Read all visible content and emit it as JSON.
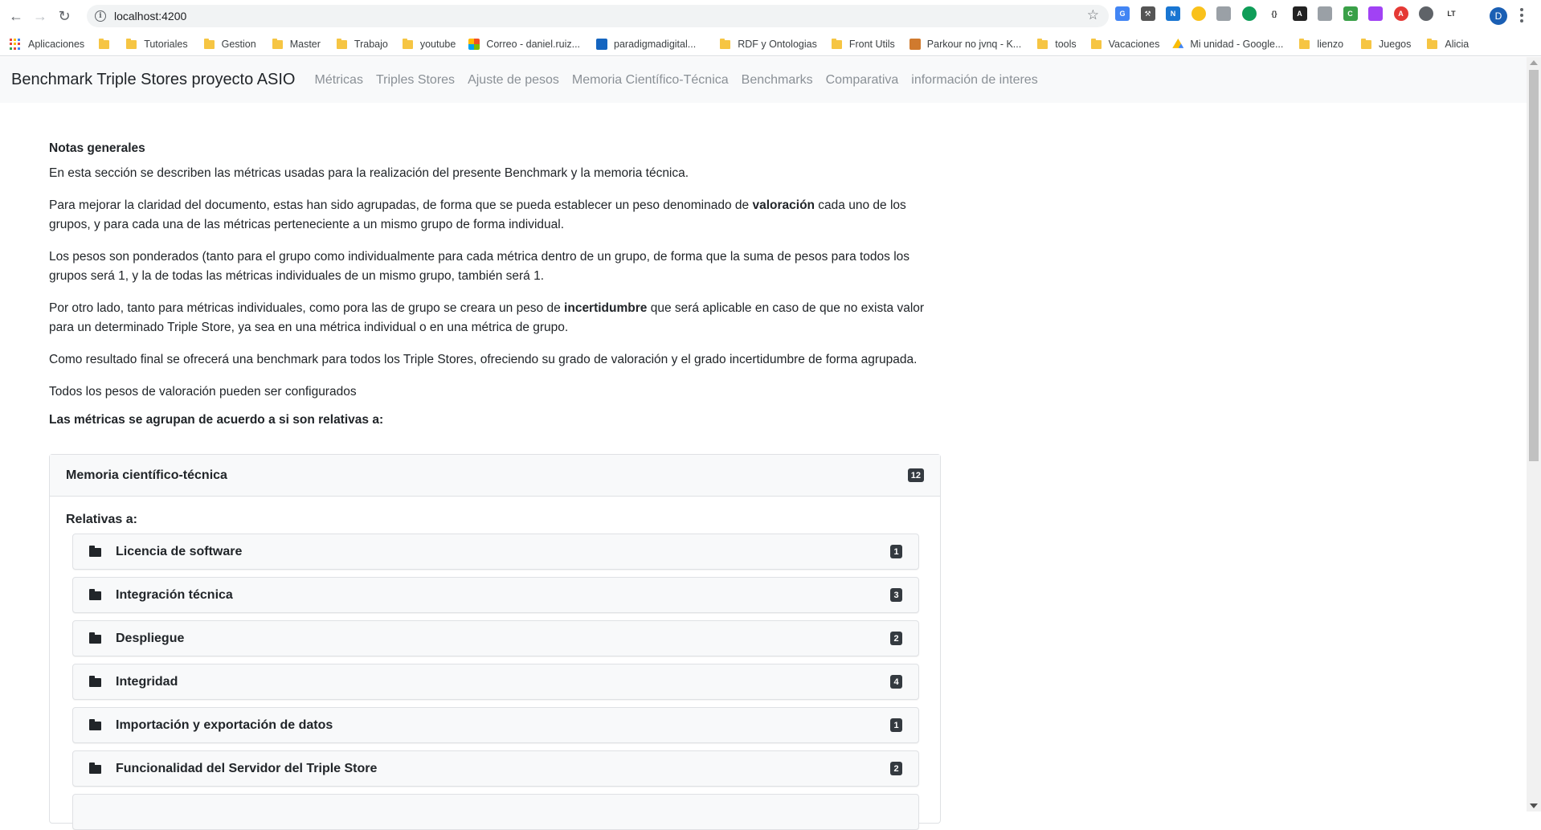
{
  "browser": {
    "url": "localhost:4200",
    "bookmarks": [
      {
        "label": "Aplicaciones",
        "icon": "apps-grid-icon"
      },
      {
        "label": "",
        "icon": "folder-icon"
      },
      {
        "label": "Tutoriales",
        "icon": "folder-icon"
      },
      {
        "label": "Gestion",
        "icon": "folder-icon"
      },
      {
        "label": "Master",
        "icon": "folder-icon"
      },
      {
        "label": "Trabajo",
        "icon": "folder-icon"
      },
      {
        "label": "youtube",
        "icon": "folder-icon"
      },
      {
        "label": "Correo - daniel.ruiz...",
        "icon": "microsoft-icon"
      },
      {
        "label": "paradigmadigital...",
        "icon": "paradigma-icon"
      },
      {
        "label": "RDF y Ontologias",
        "icon": "folder-icon"
      },
      {
        "label": "Front Utils",
        "icon": "folder-icon"
      },
      {
        "label": "Parkour no jvnq - K...",
        "icon": "parkour-icon"
      },
      {
        "label": "tools",
        "icon": "folder-icon"
      },
      {
        "label": "Vacaciones",
        "icon": "folder-icon"
      },
      {
        "label": "Mi unidad - Google...",
        "icon": "google-drive-icon"
      },
      {
        "label": "lienzo",
        "icon": "folder-icon"
      },
      {
        "label": "Juegos",
        "icon": "folder-icon"
      },
      {
        "label": "Alicia",
        "icon": "folder-icon"
      }
    ],
    "profile_initial": "D"
  },
  "navbar": {
    "brand": "Benchmark Triple Stores proyecto ASIO",
    "links": [
      "Métricas",
      "Triples Stores",
      "Ajuste de pesos",
      "Memoria Científico-Técnica",
      "Benchmarks",
      "Comparativa",
      "información de interes"
    ]
  },
  "notes": {
    "heading": "Notas generales",
    "p1": "En esta sección se describen las métricas usadas para la realización del presente Benchmark y la memoria técnica.",
    "p2_a": "Para mejorar la claridad del documento, estas han sido agrupadas, de forma que se pueda establecer un peso denominado de ",
    "p2_bold": "valoración",
    "p2_b": " cada uno de los grupos, y para cada una de las métricas perteneciente a un mismo grupo de forma individual.",
    "p3": "Los pesos son ponderados (tanto para el grupo como individualmente para cada métrica dentro de un grupo, de forma que la suma de pesos para todos los grupos será 1, y la de todas las métricas individuales de un mismo grupo, también será 1.",
    "p4_a": "Por otro lado, tanto para métricas individuales, como pora las de grupo se creara un peso de ",
    "p4_bold": "incertidumbre",
    "p4_b": " que será aplicable en caso de que no exista valor para un determinado Triple Store, ya sea en una métrica individual o en una métrica de grupo.",
    "p5": "Como resultado final se ofrecerá una benchmark para todos los Triple Stores, ofreciendo su grado de valoración y el grado incertidumbre de forma agrupada.",
    "p6": "Todos los pesos de valoración pueden ser configurados",
    "groups_title": "Las métricas se agrupan de acuerdo a si son relativas a:"
  },
  "card": {
    "title": "Memoria científico-técnica",
    "count": "12",
    "relativas": "Relativas a:",
    "items": [
      {
        "label": "Licencia de software",
        "count": "1"
      },
      {
        "label": "Integración técnica",
        "count": "3"
      },
      {
        "label": "Despliegue",
        "count": "2"
      },
      {
        "label": "Integridad",
        "count": "4"
      },
      {
        "label": "Importación y exportación de datos",
        "count": "1"
      },
      {
        "label": "Funcionalidad del Servidor del Triple Store",
        "count": "2"
      }
    ]
  }
}
